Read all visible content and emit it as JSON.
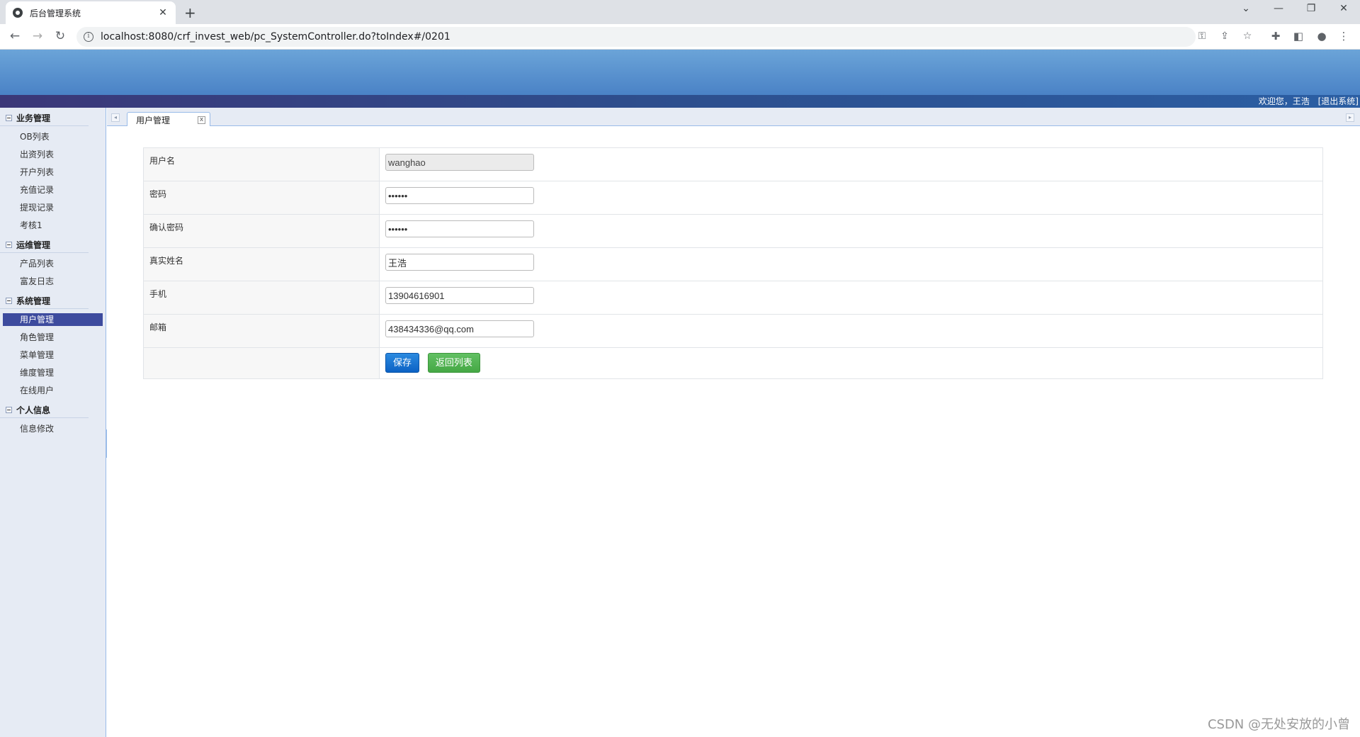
{
  "browser": {
    "tab_title": "后台管理系统",
    "tab_close": "✕",
    "new_tab": "+",
    "url": "localhost:8080/crf_invest_web/pc_SystemController.do?toIndex#/0201",
    "window_controls": {
      "dropdown": "⌄",
      "minimize": "—",
      "restore": "❐",
      "close": "✕"
    }
  },
  "header": {
    "welcome": "欢迎您，王浩",
    "logout": "[退出系统]"
  },
  "sidebar": {
    "groups": [
      {
        "title": "业务管理",
        "items": [
          "OB列表",
          "出资列表",
          "开户列表",
          "充值记录",
          "提现记录",
          "考核1"
        ]
      },
      {
        "title": "运维管理",
        "items": [
          "产品列表",
          "富友日志"
        ]
      },
      {
        "title": "系统管理",
        "items": [
          "用户管理",
          "角色管理",
          "菜单管理",
          "维度管理",
          "在线用户"
        ]
      },
      {
        "title": "个人信息",
        "items": [
          "信息修改"
        ]
      }
    ],
    "active_item": "用户管理"
  },
  "tabs": {
    "active_label": "用户管理",
    "close_label": "x"
  },
  "form": {
    "username_label": "用户名",
    "username_value": "wanghao",
    "password_label": "密码",
    "password_value": "••••••",
    "confirm_label": "确认密码",
    "confirm_value": "••••••",
    "realname_label": "真实姓名",
    "realname_value": "王浩",
    "phone_label": "手机",
    "phone_value": "13904616901",
    "email_label": "邮箱",
    "email_value": "438434336@qq.com",
    "save_label": "保存",
    "back_label": "返回列表"
  },
  "watermark": "CSDN @无处安放的小曾",
  "colors": {
    "banner_top": "#6ba4d8",
    "banner_bottom": "#4a82c6",
    "active_menu": "#3d4b9e",
    "save_button": "#1572d4",
    "back_button": "#52b352"
  }
}
